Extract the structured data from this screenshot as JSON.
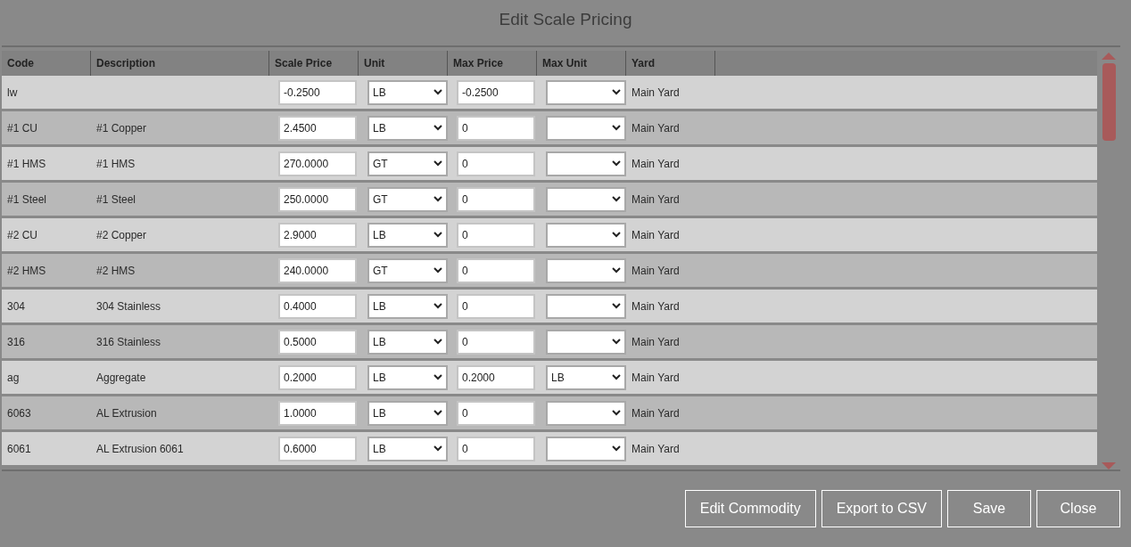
{
  "window": {
    "title": "Edit Scale Pricing"
  },
  "table": {
    "columns": [
      "Code",
      "Description",
      "Scale Price",
      "Unit",
      "Max Price",
      "Max Unit",
      "Yard"
    ],
    "rows": [
      {
        "code": "lw",
        "description": "",
        "scale_price": "-0.2500",
        "unit": "LB",
        "max_price": "-0.2500",
        "max_unit": "",
        "yard": "Main Yard"
      },
      {
        "code": "#1 CU",
        "description": "#1 Copper",
        "scale_price": "2.4500",
        "unit": "LB",
        "max_price": "0",
        "max_unit": "",
        "yard": "Main Yard"
      },
      {
        "code": "#1 HMS",
        "description": "#1 HMS",
        "scale_price": "270.0000",
        "unit": "GT",
        "max_price": "0",
        "max_unit": "",
        "yard": "Main Yard"
      },
      {
        "code": "#1 Steel",
        "description": "#1 Steel",
        "scale_price": "250.0000",
        "unit": "GT",
        "max_price": "0",
        "max_unit": "",
        "yard": "Main Yard"
      },
      {
        "code": "#2 CU",
        "description": "#2 Copper",
        "scale_price": "2.9000",
        "unit": "LB",
        "max_price": "0",
        "max_unit": "",
        "yard": "Main Yard"
      },
      {
        "code": "#2 HMS",
        "description": "#2 HMS",
        "scale_price": "240.0000",
        "unit": "GT",
        "max_price": "0",
        "max_unit": "",
        "yard": "Main Yard"
      },
      {
        "code": "304",
        "description": "304 Stainless",
        "scale_price": "0.4000",
        "unit": "LB",
        "max_price": "0",
        "max_unit": "",
        "yard": "Main Yard"
      },
      {
        "code": "316",
        "description": "316 Stainless",
        "scale_price": "0.5000",
        "unit": "LB",
        "max_price": "0",
        "max_unit": "",
        "yard": "Main Yard"
      },
      {
        "code": "ag",
        "description": "Aggregate",
        "scale_price": "0.2000",
        "unit": "LB",
        "max_price": "0.2000",
        "max_unit": "LB",
        "yard": "Main Yard"
      },
      {
        "code": "6063",
        "description": "AL Extrusion",
        "scale_price": "1.0000",
        "unit": "LB",
        "max_price": "0",
        "max_unit": "",
        "yard": "Main Yard"
      },
      {
        "code": "6061",
        "description": "AL Extrusion 6061",
        "scale_price": "0.6000",
        "unit": "LB",
        "max_price": "0",
        "max_unit": "",
        "yard": "Main Yard"
      }
    ]
  },
  "buttons": [
    "Edit Commodity",
    "Export to CSV",
    "Save",
    "Close"
  ]
}
